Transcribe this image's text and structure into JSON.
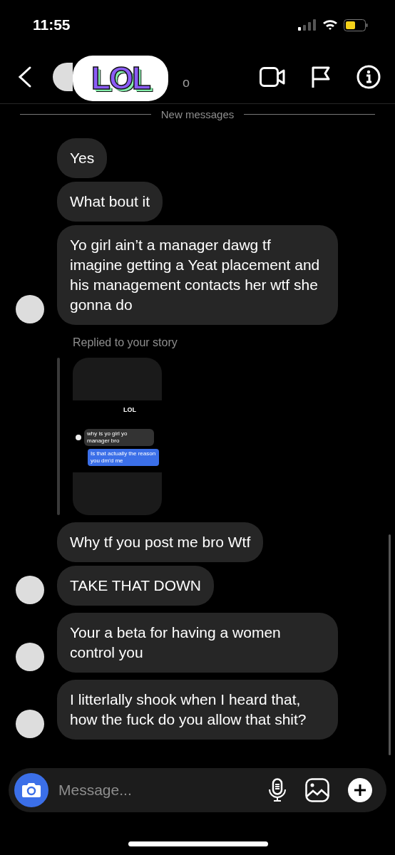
{
  "status_bar": {
    "time": "11:55"
  },
  "header": {
    "name_fragment": "o",
    "sticker": "LOL"
  },
  "divider": {
    "label": "New messages"
  },
  "thread": [
    {
      "kind": "group",
      "messages": [
        "Yes",
        "What bout it",
        "Yo girl ain’t a manager dawg tf imagine getting a Yeat placement and his management contacts her wtf she gonna do"
      ]
    },
    {
      "kind": "story",
      "label": "Replied to your story",
      "story": {
        "title": "LOL",
        "incoming": "why is yo girl yo manager bro",
        "outgoing": "Is that actually the reason you dm'd me"
      }
    },
    {
      "kind": "group",
      "messages": [
        "Why tf you post me bro Wtf",
        "TAKE THAT DOWN"
      ]
    },
    {
      "kind": "group",
      "messages": [
        "Your a beta for having a women control you"
      ]
    },
    {
      "kind": "group",
      "messages": [
        "I litterlally shook when I heard that, how the fuck do you allow that shit?"
      ]
    }
  ],
  "composer": {
    "placeholder": "Message..."
  }
}
